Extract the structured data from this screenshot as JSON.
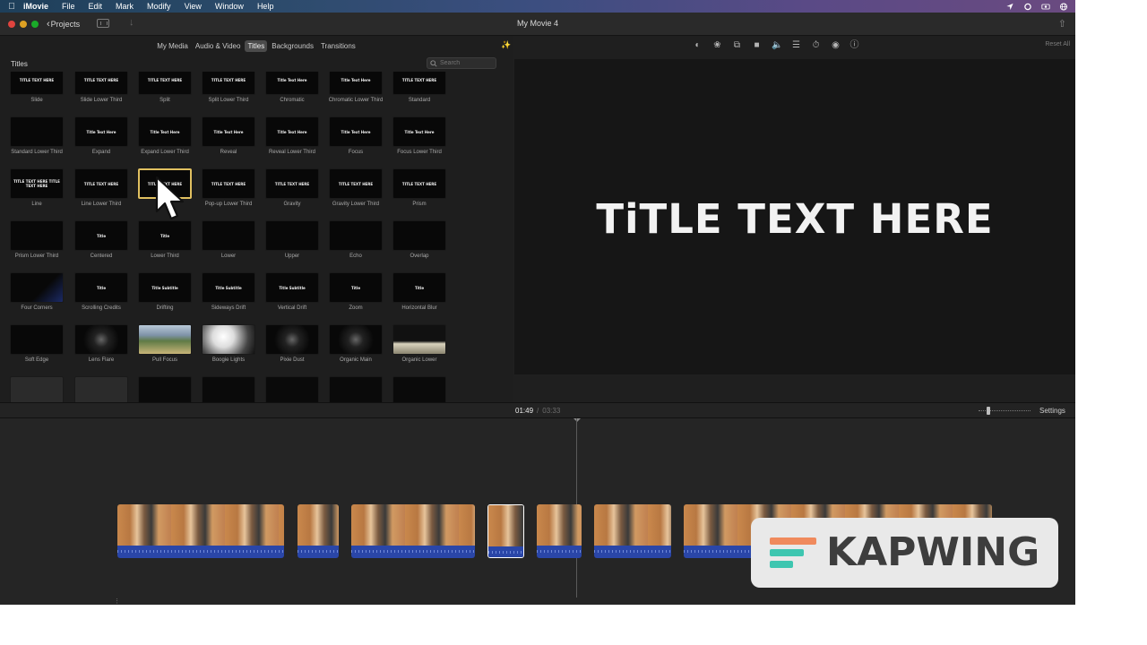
{
  "menubar": {
    "app_name": "iMovie",
    "items": [
      "File",
      "Edit",
      "Mark",
      "Modify",
      "View",
      "Window",
      "Help"
    ]
  },
  "window": {
    "title": "My Movie 4",
    "projects_label": "Projects"
  },
  "browser": {
    "tabs": [
      {
        "label": "My Media",
        "active": false
      },
      {
        "label": "Audio & Video",
        "active": false
      },
      {
        "label": "Titles",
        "active": true
      },
      {
        "label": "Backgrounds",
        "active": false
      },
      {
        "label": "Transitions",
        "active": false
      }
    ],
    "section_title": "Titles",
    "search_placeholder": "Search",
    "titles": [
      {
        "name": "Slide",
        "thumb_text": "TITLE TEXT HERE"
      },
      {
        "name": "Slide Lower Third",
        "thumb_text": "TITLE TEXT HERE"
      },
      {
        "name": "Split",
        "thumb_text": "TITLE TEXT HERE"
      },
      {
        "name": "Split Lower Third",
        "thumb_text": "TITLE TEXT HERE"
      },
      {
        "name": "Chromatic",
        "thumb_text": "Title Text Here"
      },
      {
        "name": "Chromatic Lower Third",
        "thumb_text": "Title Text Here"
      },
      {
        "name": "Standard",
        "thumb_text": "TITLE TEXT HERE"
      },
      {
        "name": "Standard Lower Third",
        "thumb_text": ""
      },
      {
        "name": "Expand",
        "thumb_text": "Title Text Here"
      },
      {
        "name": "Expand Lower Third",
        "thumb_text": "Title Text Here"
      },
      {
        "name": "Reveal",
        "thumb_text": "Title Text Here"
      },
      {
        "name": "Reveal Lower Third",
        "thumb_text": "Title Text Here"
      },
      {
        "name": "Focus",
        "thumb_text": "Title Text Here"
      },
      {
        "name": "Focus Lower Third",
        "thumb_text": "Title Text Here"
      },
      {
        "name": "Line",
        "thumb_text": "TITLE TEXT HERE TITLE TEXT HERE"
      },
      {
        "name": "Line Lower Third",
        "thumb_text": "TITLE TEXT HERE"
      },
      {
        "name": "",
        "thumb_text": "TITLE TEXT HERE",
        "selected": true
      },
      {
        "name": "Pop-up Lower Third",
        "thumb_text": "TITLE TEXT HERE"
      },
      {
        "name": "Gravity",
        "thumb_text": "TITLE TEXT HERE"
      },
      {
        "name": "Gravity Lower Third",
        "thumb_text": "TITLE TEXT HERE"
      },
      {
        "name": "Prism",
        "thumb_text": "TITLE TEXT HERE"
      },
      {
        "name": "Prism Lower Third",
        "thumb_text": ""
      },
      {
        "name": "Centered",
        "thumb_text": "Title"
      },
      {
        "name": "Lower Third",
        "thumb_text": "Title"
      },
      {
        "name": "Lower",
        "thumb_text": ""
      },
      {
        "name": "Upper",
        "thumb_text": ""
      },
      {
        "name": "Echo",
        "thumb_text": ""
      },
      {
        "name": "Overlap",
        "thumb_text": ""
      },
      {
        "name": "Four Corners",
        "thumb_text": ""
      },
      {
        "name": "Scrolling Credits",
        "thumb_text": "Title"
      },
      {
        "name": "Drifting",
        "thumb_text": "Title Subtitle"
      },
      {
        "name": "Sideways Drift",
        "thumb_text": "Title Subtitle"
      },
      {
        "name": "Vertical Drift",
        "thumb_text": "Title Subtitle"
      },
      {
        "name": "Zoom",
        "thumb_text": "Title"
      },
      {
        "name": "Horizontal Blur",
        "thumb_text": "Title"
      },
      {
        "name": "Soft Edge",
        "thumb_text": ""
      },
      {
        "name": "Lens Flare",
        "thumb_text": ""
      },
      {
        "name": "Pull Focus",
        "thumb_text": ""
      },
      {
        "name": "Boogie Lights",
        "thumb_text": ""
      },
      {
        "name": "Pixie Dust",
        "thumb_text": ""
      },
      {
        "name": "Organic Main",
        "thumb_text": ""
      },
      {
        "name": "Organic Lower",
        "thumb_text": ""
      }
    ]
  },
  "viewer": {
    "reset_label": "Reset All",
    "preview_text": "TiTLE TEXT HERE",
    "tools": [
      "color-balance-icon",
      "color-correction-icon",
      "crop-icon",
      "stabilization-icon",
      "volume-icon",
      "noise-reduction-icon",
      "speed-icon",
      "clip-filter-icon",
      "info-icon"
    ]
  },
  "timeline": {
    "current_time": "01:49",
    "separator": "/",
    "total_time": "03:33",
    "settings_label": "Settings",
    "clips": [
      {
        "label": "clip-1",
        "selected": false
      },
      {
        "label": "clip-2",
        "selected": false
      },
      {
        "label": "clip-3",
        "selected": false
      },
      {
        "label": "clip-4",
        "selected": true
      },
      {
        "label": "clip-5",
        "selected": false
      },
      {
        "label": "clip-6",
        "selected": false
      },
      {
        "label": "clip-7",
        "selected": false
      }
    ]
  },
  "watermark": {
    "text": "KAPWING",
    "colors": {
      "teal": "#3ec6b0",
      "orange": "#f08a5d",
      "bg": "#e9e9e9",
      "text": "#3d3d3d"
    }
  },
  "colors": {
    "selection": "#e0c060",
    "audio": "#2a46a8",
    "window_bg": "#1e1e1e"
  }
}
